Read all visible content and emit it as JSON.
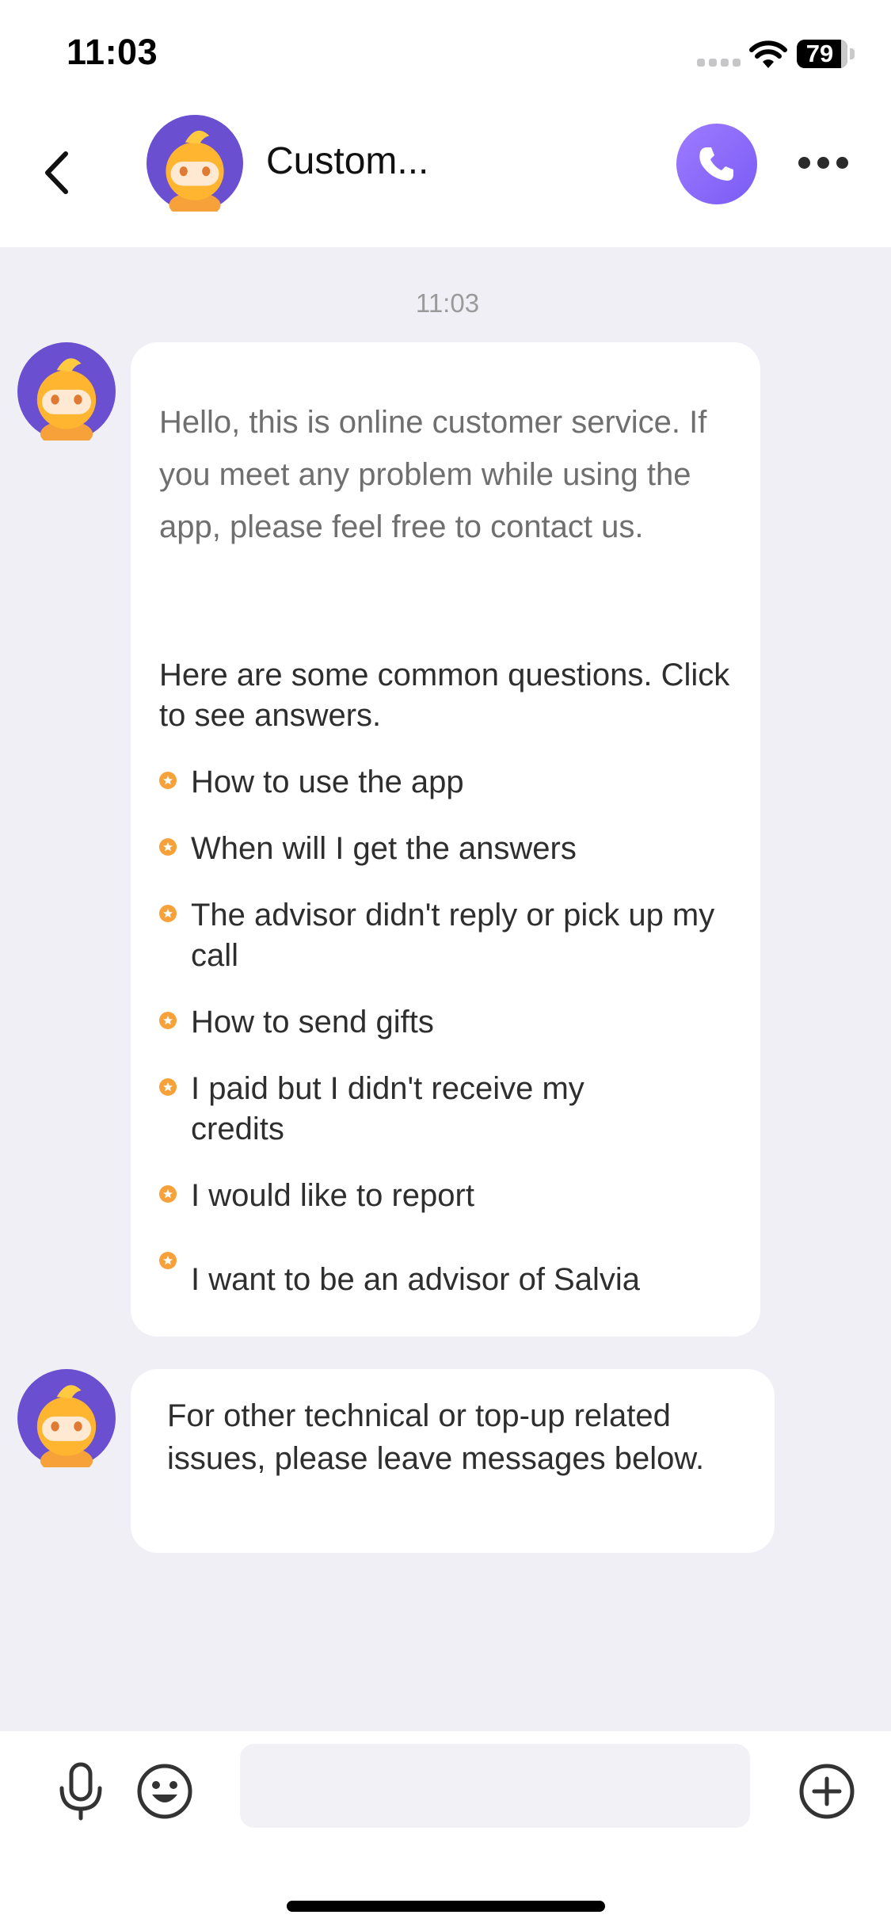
{
  "status_bar": {
    "time": "11:03",
    "battery_level": "79",
    "icons": [
      "signal-icon",
      "wifi-icon",
      "battery-icon"
    ]
  },
  "header": {
    "title": "Custom...",
    "icons": [
      "back-icon",
      "avatar",
      "phone-icon",
      "more-icon"
    ],
    "accent_color": "#8a6af8"
  },
  "chat": {
    "timestamp": "11:03",
    "greeting": "Hello, this is online customer service. If you meet any problem while using the app, please feel free to contact us.",
    "faq_intro": "Here are some common questions. Click to see answers.",
    "faq_items": [
      "How to use the app",
      "When will I get the answers",
      "The advisor didn't reply or pick up my call",
      "How to send gifts",
      "I paid but I didn't receive my credits",
      "I would like to report",
      "I want to be an advisor of Salvia"
    ],
    "other_issues": "For other technical or top-up related issues, please leave messages below."
  },
  "input_bar": {
    "placeholder": "",
    "icons": [
      "microphone-icon",
      "emoji-icon",
      "add-icon"
    ]
  }
}
